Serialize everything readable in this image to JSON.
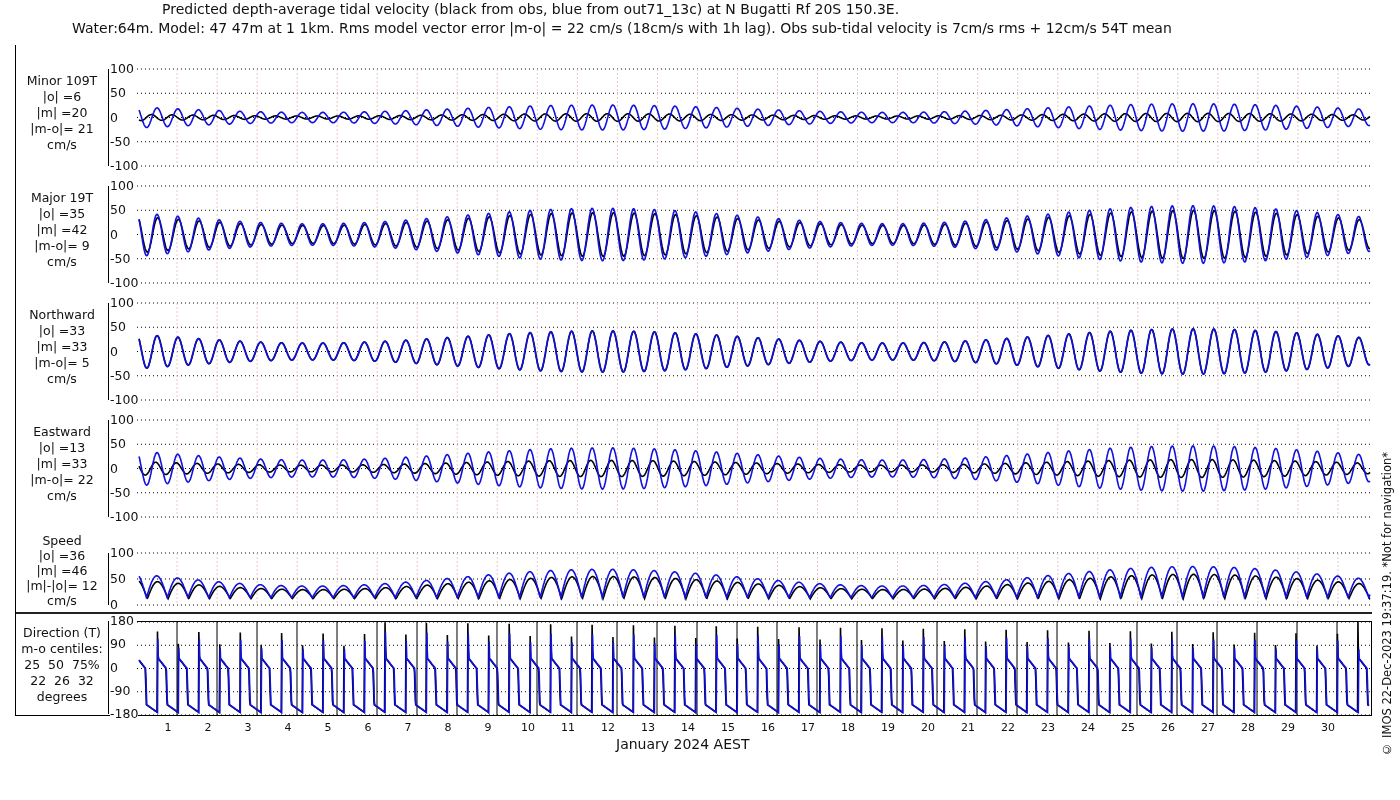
{
  "title_lines": [
    "Predicted depth-average tidal velocity (black from obs, blue from out71_13c) at N Bugatti Rf 20S 150.3E.",
    "Water:64m. Model: 47 47m at 1 1km. Rms model vector error |m-o| = 22 cm/s (18cm/s with 1h lag). Obs sub-tidal velocity is 7cm/s rms + 12cm/s 54T mean"
  ],
  "panels": [
    {
      "kind": "velocity",
      "label_lines": [
        "Minor 109T",
        "|o| =6",
        "|m| =20",
        "|m-o|= 21",
        "cm/s"
      ],
      "yticks": [
        "100",
        "50",
        "0",
        "-50",
        "-100"
      ]
    },
    {
      "kind": "velocity",
      "label_lines": [
        "Major 19T",
        "|o| =35",
        "|m| =42",
        "|m-o|= 9",
        "cm/s"
      ],
      "yticks": [
        "100",
        "50",
        "0",
        "-50",
        "-100"
      ]
    },
    {
      "kind": "velocity",
      "label_lines": [
        "Northward",
        "|o| =33",
        "|m| =33",
        "|m-o|= 5",
        "cm/s"
      ],
      "yticks": [
        "100",
        "50",
        "0",
        "-50",
        "-100"
      ]
    },
    {
      "kind": "velocity",
      "label_lines": [
        "Eastward",
        "|o| =13",
        "|m| =33",
        "|m-o|= 22",
        "cm/s"
      ],
      "yticks": [
        "100",
        "50",
        "0",
        "-50",
        "-100"
      ]
    },
    {
      "kind": "speed",
      "label_lines": [
        "Speed",
        "|o| =36",
        "|m| =46",
        "|m|-|o|= 12",
        "cm/s"
      ],
      "yticks": [
        "100",
        "50",
        "0"
      ]
    },
    {
      "kind": "direction",
      "label_lines": [
        "Direction (T)",
        "m-o centiles:",
        "25  50  75%",
        "22  26  32",
        "degrees"
      ],
      "yticks": [
        "180",
        "90",
        "0",
        "-90",
        "-180"
      ]
    }
  ],
  "xaxis": {
    "days": [
      "1",
      "2",
      "3",
      "4",
      "5",
      "6",
      "7",
      "8",
      "9",
      "10",
      "11",
      "12",
      "13",
      "14",
      "15",
      "16",
      "17",
      "18",
      "19",
      "20",
      "21",
      "22",
      "23",
      "24",
      "25",
      "26",
      "27",
      "28",
      "29",
      "30"
    ],
    "label": "January 2024 AEST"
  },
  "side_note": "© IMOS 22-Dec-2023 19:37:19. *Not for navigation*"
}
